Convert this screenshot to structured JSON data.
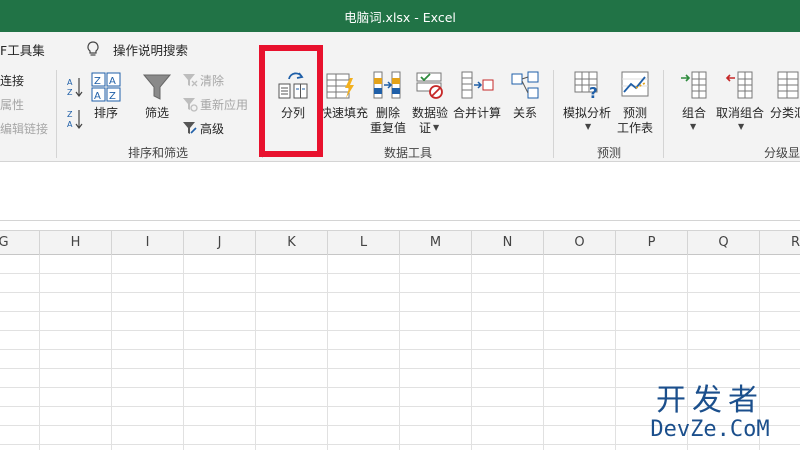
{
  "window": {
    "title": "电脑词.xlsx  -  Excel"
  },
  "tellme_row": {
    "pdf_tab": "F工具集",
    "tellme_text": "操作说明搜索",
    "tellme_icon": "lightbulb-icon"
  },
  "ribbon": {
    "connections": {
      "items": [
        "连接",
        "属性",
        "编辑链接"
      ]
    },
    "sort_filter": {
      "az_icon": "sort-az-icon",
      "za_icon": "sort-za-icon",
      "sort": "排序",
      "filter": "筛选",
      "clear": "清除",
      "reapply": "重新应用",
      "advanced": "高级",
      "group_label": "排序和筛选"
    },
    "data_tools": {
      "text_to_columns": "分列",
      "flash_fill": "快速填充",
      "remove_duplicates_line1": "删除",
      "remove_duplicates_line2": "重复值",
      "data_validation_line1": "数据验",
      "data_validation_line2": "证",
      "consolidate": "合并计算",
      "relationships": "关系",
      "group_label": "数据工具"
    },
    "forecast": {
      "whatif": "模拟分析",
      "forecast_sheet_line1": "预测",
      "forecast_sheet_line2": "工作表",
      "group_label": "预测"
    },
    "outline": {
      "group": "组合",
      "ungroup": "取消组合",
      "subtotal": "分类汇",
      "group_label": "分级显"
    }
  },
  "sheet": {
    "columns": [
      "G",
      "H",
      "I",
      "J",
      "K",
      "L",
      "M",
      "N",
      "O",
      "P",
      "Q",
      "R"
    ]
  },
  "watermark": {
    "cn": "开发者",
    "en": "DevZe.CoM"
  },
  "colors": {
    "excel_green": "#217346",
    "highlight_red": "#e8112d",
    "ribbon_bg": "#f3f3f3"
  }
}
